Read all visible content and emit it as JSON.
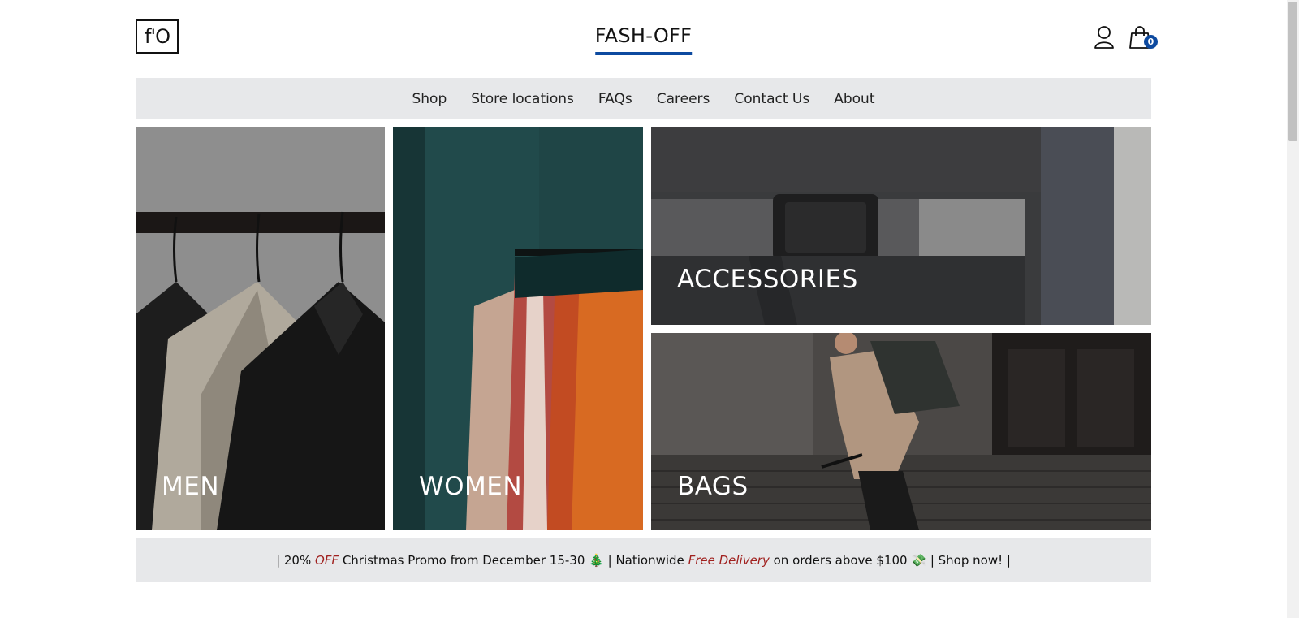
{
  "header": {
    "logo_text": "f'O",
    "brand_title": "FASH-OFF",
    "account_icon": "user-icon",
    "cart_icon": "shopping-bag-icon",
    "cart_count": "0",
    "accent_color": "#0d4aa0"
  },
  "nav": {
    "items": [
      "Shop",
      "Store locations",
      "FAQs",
      "Careers",
      "Contact Us",
      "About"
    ]
  },
  "categories": [
    {
      "label": "MEN"
    },
    {
      "label": "WOMEN"
    },
    {
      "label": "ACCESSORIES"
    },
    {
      "label": "BAGS"
    }
  ],
  "promo": {
    "part1": "| 20% ",
    "off": "OFF",
    "part2": " Christmas Promo from December 15-30 ",
    "tree_emoji": "🎄",
    "part3": " | Nationwide ",
    "free_delivery": "Free Delivery",
    "part4": " on orders above $100 ",
    "gift_emoji": "💸",
    "part5": " | Shop now! |",
    "highlight_color": "#a0201e"
  }
}
